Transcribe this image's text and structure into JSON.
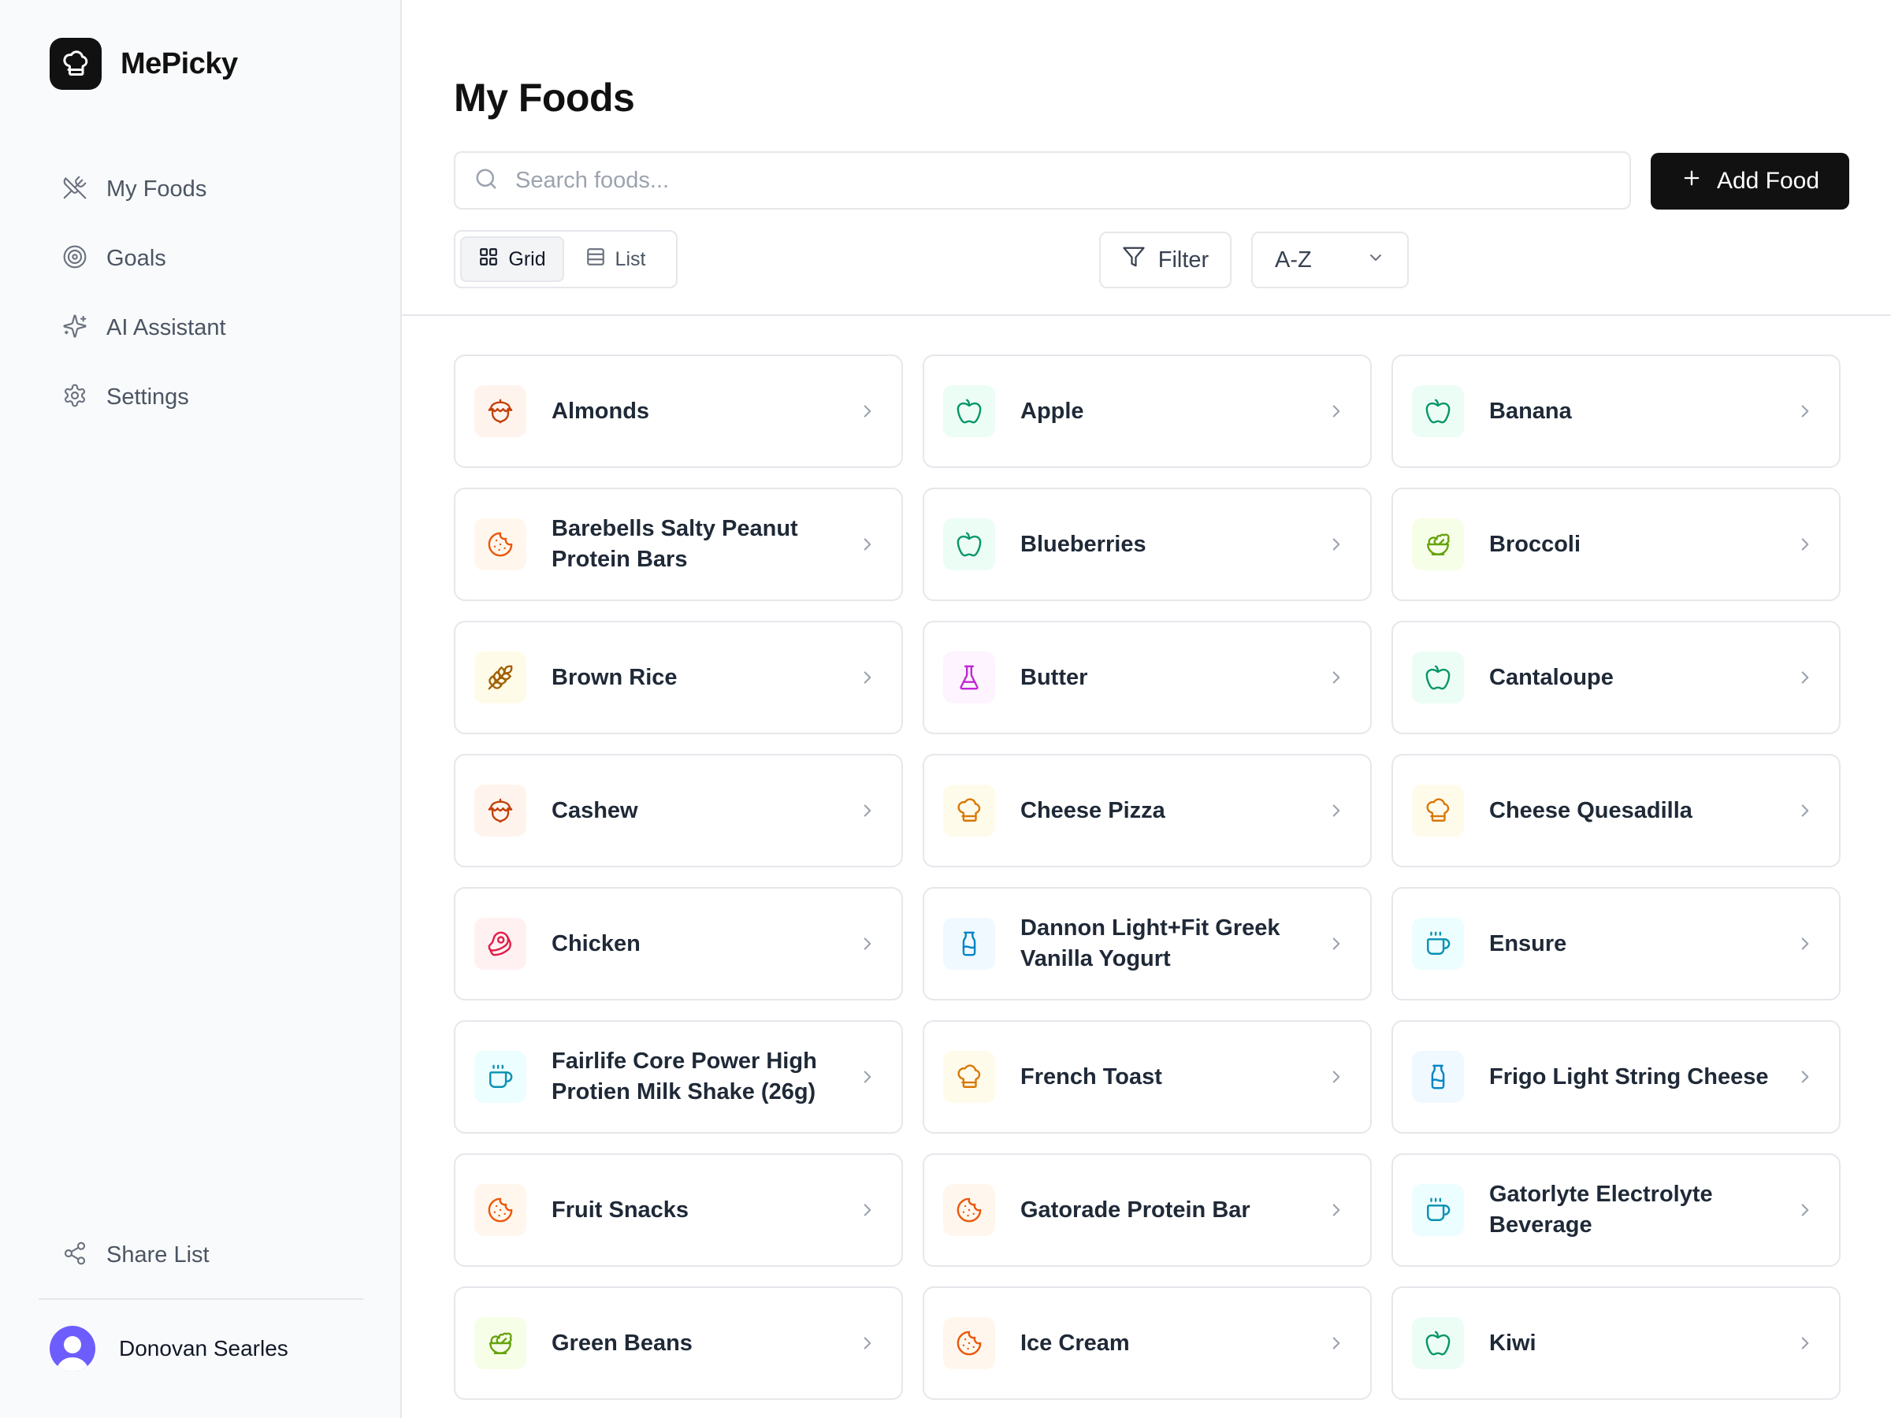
{
  "brand": {
    "name": "MePicky",
    "logo_icon": "chef-hat-icon"
  },
  "sidebar": {
    "items": [
      {
        "label": "My Foods",
        "icon": "utensils-crossed-icon"
      },
      {
        "label": "Goals",
        "icon": "target-icon"
      },
      {
        "label": "AI Assistant",
        "icon": "sparkles-icon"
      },
      {
        "label": "Settings",
        "icon": "gear-icon"
      }
    ],
    "share_label": "Share List",
    "user_name": "Donovan Searles"
  },
  "main": {
    "title": "My Foods",
    "search_placeholder": "Search foods...",
    "add_label": "Add Food",
    "view_grid_label": "Grid",
    "view_list_label": "List",
    "filter_label": "Filter",
    "sort_value": "A-Z"
  },
  "colors": {
    "accent": "#111111",
    "nut": "#c2410c",
    "nut_bg": "#fff4ed",
    "fruit": "#059669",
    "fruit_bg": "#ecfdf5",
    "veg": "#65a30d",
    "veg_bg": "#f7fee7",
    "snack": "#ea580c",
    "snack_bg": "#fff7ed",
    "grain": "#a16207",
    "grain_bg": "#fefce8",
    "dairy": "#c026d3",
    "dairy_bg": "#fdf4ff",
    "meal": "#d97706",
    "meal_bg": "#fffbeb",
    "meat": "#e11d48",
    "meat_bg": "#fff1f2",
    "bottle": "#0284c7",
    "bottle_bg": "#f0f9ff",
    "drink": "#0891b2",
    "drink_bg": "#ecfeff"
  },
  "foods": [
    {
      "name": "Almonds",
      "icon": "nut-icon",
      "category": "nut"
    },
    {
      "name": "Apple",
      "icon": "apple-icon",
      "category": "fruit"
    },
    {
      "name": "Banana",
      "icon": "apple-icon",
      "category": "fruit"
    },
    {
      "name": "Barebells Salty Peanut Protein Bars",
      "icon": "cookie-icon",
      "category": "snack"
    },
    {
      "name": "Blueberries",
      "icon": "apple-icon",
      "category": "fruit"
    },
    {
      "name": "Broccoli",
      "icon": "salad-icon",
      "category": "veg"
    },
    {
      "name": "Brown Rice",
      "icon": "wheat-icon",
      "category": "grain"
    },
    {
      "name": "Butter",
      "icon": "flask-icon",
      "category": "dairy"
    },
    {
      "name": "Cantaloupe",
      "icon": "apple-icon",
      "category": "fruit"
    },
    {
      "name": "Cashew",
      "icon": "nut-icon",
      "category": "nut"
    },
    {
      "name": "Cheese Pizza",
      "icon": "chef-hat-icon",
      "category": "meal"
    },
    {
      "name": "Cheese Quesadilla",
      "icon": "chef-hat-icon",
      "category": "meal"
    },
    {
      "name": "Chicken",
      "icon": "beef-icon",
      "category": "meat"
    },
    {
      "name": "Dannon Light+Fit Greek Vanilla Yogurt",
      "icon": "milk-bottle-icon",
      "category": "bottle"
    },
    {
      "name": "Ensure",
      "icon": "coffee-cup-icon",
      "category": "drink"
    },
    {
      "name": "Fairlife Core Power High Protien Milk Shake (26g)",
      "icon": "coffee-cup-icon",
      "category": "drink"
    },
    {
      "name": "French Toast",
      "icon": "chef-hat-icon",
      "category": "meal"
    },
    {
      "name": "Frigo Light String Cheese",
      "icon": "milk-bottle-icon",
      "category": "bottle"
    },
    {
      "name": "Fruit Snacks",
      "icon": "cookie-icon",
      "category": "snack"
    },
    {
      "name": "Gatorade Protein Bar",
      "icon": "cookie-icon",
      "category": "snack"
    },
    {
      "name": "Gatorlyte Electrolyte Beverage",
      "icon": "coffee-cup-icon",
      "category": "drink"
    },
    {
      "name": "Green Beans",
      "icon": "salad-icon",
      "category": "veg"
    },
    {
      "name": "Ice Cream",
      "icon": "cookie-icon",
      "category": "snack"
    },
    {
      "name": "Kiwi",
      "icon": "apple-icon",
      "category": "fruit"
    }
  ]
}
